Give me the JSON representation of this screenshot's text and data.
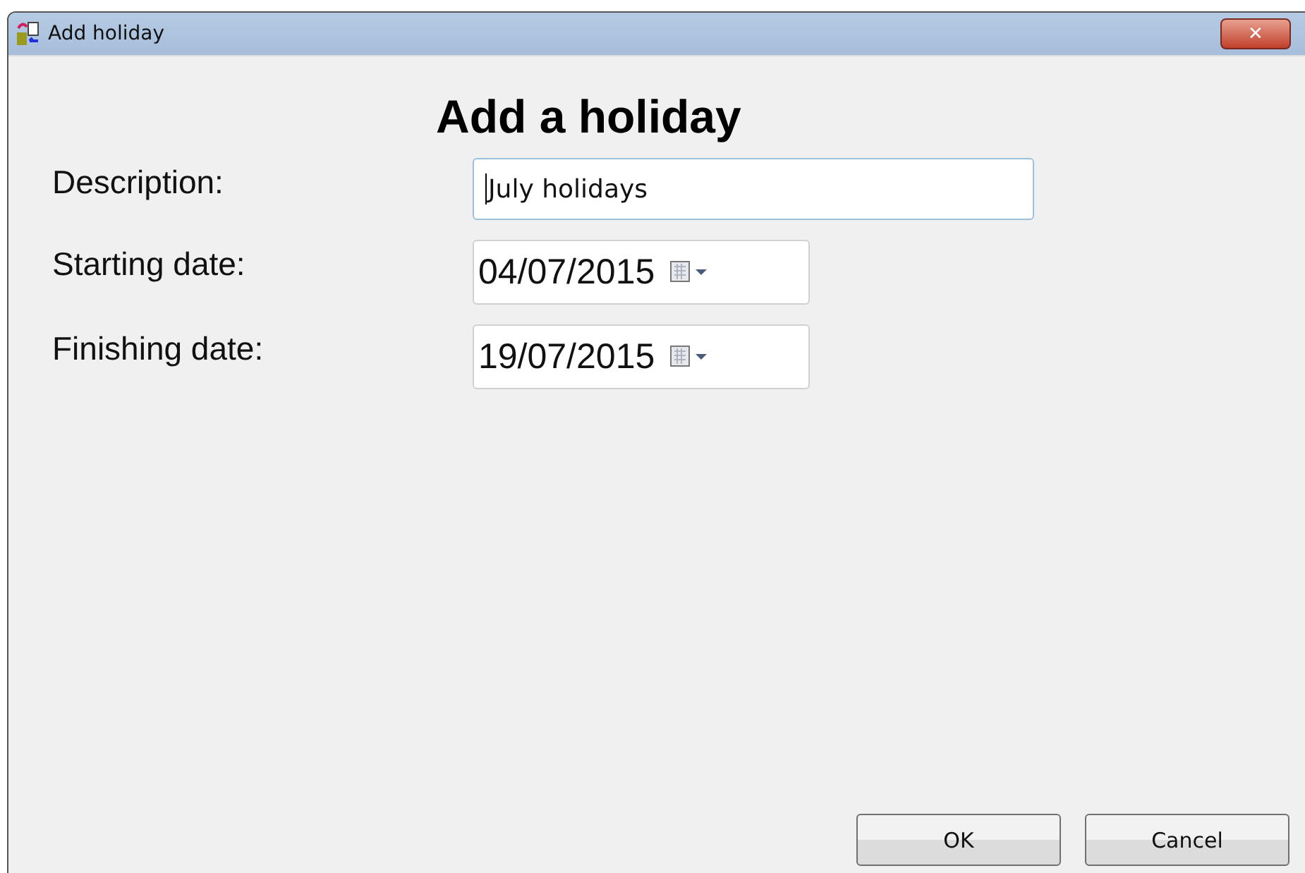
{
  "window": {
    "title": "Add holiday",
    "close": "✕"
  },
  "heading": "Add a holiday",
  "fields": [
    {
      "label": "Description:",
      "kind": "text",
      "value": "July holidays"
    },
    {
      "label": "Starting date:",
      "kind": "date",
      "value": "04/07/2015"
    },
    {
      "label": "Finishing date:",
      "kind": "date",
      "value": "19/07/2015"
    }
  ],
  "buttons": [
    "OK",
    "Cancel"
  ]
}
